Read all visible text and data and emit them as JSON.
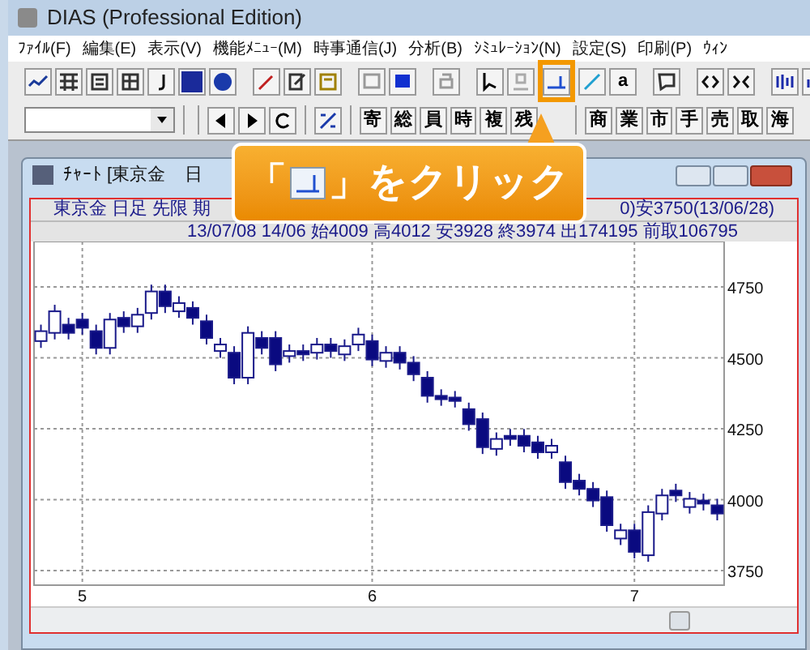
{
  "window": {
    "title": "DIAS (Professional Edition)"
  },
  "menu": [
    "ﾌｧｲﾙ(F)",
    "編集(E)",
    "表示(V)",
    "機能ﾒﾆｭｰ(M)",
    "時事通信(J)",
    "分析(B)",
    "ｼﾐｭﾚｰｼｮﾝ(N)",
    "設定(S)",
    "印刷(P)",
    "ｳｨﾝ"
  ],
  "toolbar": {
    "buttons": [
      {
        "highlighted": false
      },
      {
        "highlighted": false
      },
      {
        "highlighted": true
      },
      {
        "highlighted": false
      },
      {
        "highlighted": false
      }
    ]
  },
  "toolbar_2": {
    "letter_button": "a",
    "kanji_buttons": [
      "寄",
      "総",
      "員",
      "時",
      "複",
      "残"
    ],
    "kanji_buttons_2": [
      "商",
      "業",
      "市",
      "手",
      "売",
      "取",
      "海"
    ]
  },
  "chart_window": {
    "title": "ﾁｬｰﾄ [東京金",
    "title_2": "日",
    "header_1_left": "東京金 日足 先限 期",
    "header_1_right": "0)安3750(13/06/28)",
    "header_2": "13/07/08 14/06 始4009 高4012 安3928 終3974 出174195 前取106795",
    "chart_data": {
      "type": "candlestick",
      "categories": [
        null,
        null,
        null,
        "5",
        null,
        null,
        null,
        null,
        null,
        null,
        null,
        null,
        null,
        null,
        null,
        null,
        null,
        null,
        null,
        null,
        null,
        null,
        null,
        null,
        "6",
        null,
        null,
        null,
        null,
        null,
        null,
        null,
        null,
        null,
        null,
        null,
        null,
        null,
        null,
        null,
        null,
        null,
        null,
        "7",
        null,
        null,
        null,
        null,
        null,
        null
      ],
      "ohlc": [
        [
          4559,
          4617,
          4535,
          4594
        ],
        [
          4588,
          4687,
          4565,
          4664
        ],
        [
          4617,
          4641,
          4565,
          4588
        ],
        [
          4635,
          4658,
          4582,
          4606
        ],
        [
          4594,
          4617,
          4512,
          4535
        ],
        [
          4535,
          4658,
          4512,
          4635
        ],
        [
          4641,
          4664,
          4588,
          4611
        ],
        [
          4611,
          4676,
          4588,
          4652
        ],
        [
          4658,
          4758,
          4635,
          4734
        ],
        [
          4734,
          4758,
          4658,
          4682
        ],
        [
          4664,
          4717,
          4641,
          4693
        ],
        [
          4676,
          4699,
          4617,
          4641
        ],
        [
          4629,
          4652,
          4547,
          4570
        ],
        [
          4524,
          4570,
          4500,
          4547
        ],
        [
          4518,
          4541,
          4407,
          4430
        ],
        [
          4430,
          4611,
          4407,
          4588
        ],
        [
          4570,
          4594,
          4512,
          4535
        ],
        [
          4570,
          4594,
          4453,
          4477
        ],
        [
          4506,
          4547,
          4483,
          4524
        ],
        [
          4524,
          4547,
          4489,
          4512
        ],
        [
          4518,
          4570,
          4494,
          4547
        ],
        [
          4547,
          4570,
          4500,
          4524
        ],
        [
          4512,
          4565,
          4489,
          4541
        ],
        [
          4547,
          4606,
          4524,
          4582
        ],
        [
          4559,
          4582,
          4471,
          4494
        ],
        [
          4489,
          4541,
          4465,
          4518
        ],
        [
          4518,
          4541,
          4459,
          4483
        ],
        [
          4483,
          4506,
          4418,
          4442
        ],
        [
          4430,
          4453,
          4342,
          4366
        ],
        [
          4366,
          4389,
          4331,
          4354
        ],
        [
          4360,
          4383,
          4325,
          4348
        ],
        [
          4319,
          4342,
          4243,
          4266
        ],
        [
          4284,
          4307,
          4161,
          4185
        ],
        [
          4179,
          4237,
          4155,
          4214
        ],
        [
          4225,
          4249,
          4190,
          4214
        ],
        [
          4225,
          4249,
          4167,
          4190
        ],
        [
          4202,
          4225,
          4144,
          4167
        ],
        [
          4167,
          4214,
          4144,
          4190
        ],
        [
          4132,
          4155,
          4038,
          4062
        ],
        [
          4067,
          4091,
          4015,
          4038
        ],
        [
          4038,
          4062,
          3974,
          3997
        ],
        [
          4009,
          4032,
          3887,
          3910
        ],
        [
          3863,
          3915,
          3840,
          3892
        ],
        [
          3892,
          3915,
          3793,
          3816
        ],
        [
          3804,
          3980,
          3781,
          3956
        ],
        [
          3951,
          4038,
          3927,
          4015
        ],
        [
          4032,
          4056,
          3992,
          4015
        ],
        [
          3974,
          4027,
          3951,
          4003
        ],
        [
          3997,
          4021,
          3962,
          3986
        ],
        [
          3980,
          4003,
          3927,
          3951
        ]
      ],
      "yticks": [
        4750,
        4500,
        4250,
        4000,
        3750
      ],
      "ylim": [
        3750,
        4750
      ],
      "grid": true
    }
  },
  "callout": {
    "before": "「",
    "after": "」をクリック"
  }
}
